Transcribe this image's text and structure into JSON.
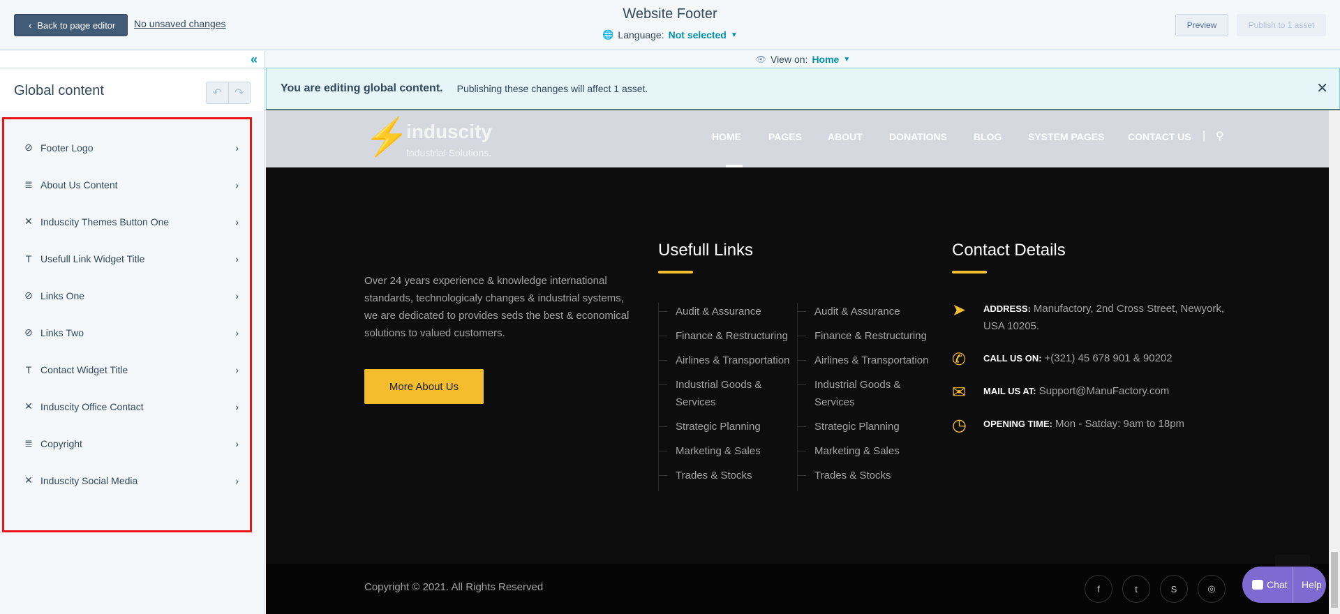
{
  "topbar": {
    "back_label": "Back to page editor",
    "unsaved_label": "No unsaved changes",
    "title": "Website Footer",
    "language_label": "Language:",
    "language_value": "Not selected",
    "preview_label": "Preview",
    "publish_label": "Publish to 1 asset"
  },
  "sidebar": {
    "title": "Global content",
    "modules": [
      {
        "label": "Footer Logo",
        "icon": "logo-icon"
      },
      {
        "label": "About Us Content",
        "icon": "rich-text-icon"
      },
      {
        "label": "Induscity Themes Button One",
        "icon": "custom-module-icon"
      },
      {
        "label": "Usefull Link Widget Title",
        "icon": "text-icon"
      },
      {
        "label": "Links One",
        "icon": "compass-icon"
      },
      {
        "label": "Links Two",
        "icon": "compass-icon"
      },
      {
        "label": "Contact Widget Title",
        "icon": "text-icon"
      },
      {
        "label": "Induscity Office Contact",
        "icon": "custom-module-icon"
      },
      {
        "label": "Copyright",
        "icon": "rich-text-icon"
      },
      {
        "label": "Induscity Social Media",
        "icon": "custom-module-icon"
      }
    ]
  },
  "preview": {
    "view_on_label": "View on:",
    "view_on_value": "Home",
    "banner_title": "You are editing global content.",
    "banner_text": "Publishing these changes will affect 1 asset.",
    "site": {
      "logo_name": "induscity",
      "logo_sub": "Industrial Solutions.",
      "nav": [
        "HOME",
        "PAGES",
        "ABOUT",
        "DONATIONS",
        "BLOG",
        "SYSTEM PAGES",
        "CONTACT US"
      ]
    },
    "footer": {
      "about_text": "Over 24 years experience & knowledge international standards, technologicaly changes & industrial systems, we are dedicated to provides seds the best & economical solutions to valued customers.",
      "more_button": "More About Us",
      "links_title": "Usefull Links",
      "links_one": [
        "Audit & Assurance",
        "Finance & Restructuring",
        "Airlines & Transportation",
        "Industrial Goods & Services",
        "Strategic Planning",
        "Marketing & Sales",
        "Trades & Stocks"
      ],
      "links_two": [
        "Audit & Assurance",
        "Finance & Restructuring",
        "Airlines & Transportation",
        "Industrial Goods & Services",
        "Strategic Planning",
        "Marketing & Sales",
        "Trades & Stocks"
      ],
      "contact_title": "Contact Details",
      "contacts": [
        {
          "label": "ADDRESS:",
          "value": "Manufactory, 2nd Cross Street, Newyork, USA 10205.",
          "icon": "location-arrow-icon"
        },
        {
          "label": "CALL US ON:",
          "value": "+(321) 45 678 901 & 90202",
          "icon": "phone-icon"
        },
        {
          "label": "MAIL US AT:",
          "value": "Support@ManuFactory.com",
          "icon": "mail-icon"
        },
        {
          "label": "OPENING TIME:",
          "value": "Mon - Satday: 9am to 18pm",
          "icon": "clock-icon"
        }
      ],
      "copyright": "Copyright © 2021. All Rights Reserved",
      "social": [
        "facebook-icon",
        "twitter-icon",
        "skype-icon",
        "instagram-icon"
      ]
    },
    "chat_widget": {
      "chat_label": "Chat",
      "help_label": "Help"
    }
  }
}
